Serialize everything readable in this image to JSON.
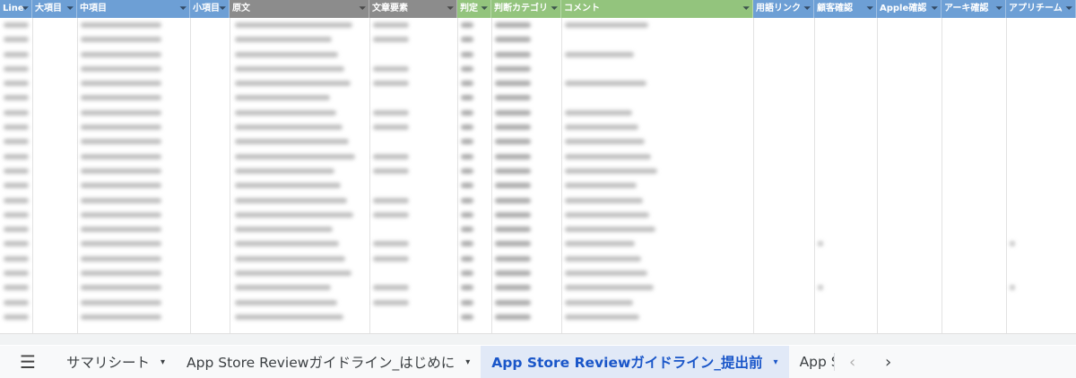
{
  "header": {
    "columns": [
      {
        "label": "Line",
        "filter": "⏷"
      },
      {
        "label": "大項目",
        "filter": "⏷"
      },
      {
        "label": "中項目",
        "filter": "⏷"
      },
      {
        "label": "小項目",
        "filter": "⏷"
      },
      {
        "label": "原文",
        "filter": "⏷"
      },
      {
        "label": "文章要素",
        "filter": "⏷"
      },
      {
        "label": "判定",
        "filter": "⏷"
      },
      {
        "label": "判断カテゴリ",
        "filter": "⏷"
      },
      {
        "label": "コメント",
        "filter": "⏷"
      },
      {
        "label": "用語リンク",
        "filter": "⏷"
      },
      {
        "label": "顧客確認",
        "filter": "⏷"
      },
      {
        "label": "Apple確認",
        "filter": "⏷"
      },
      {
        "label": "アーキ確認",
        "filter": "⏷"
      },
      {
        "label": "アプリチーム",
        "filter": "⏷"
      }
    ],
    "colors": {
      "blue": "#6d9fd5",
      "gray": "#8c8c8c",
      "green": "#93c47d"
    }
  },
  "sheet_tabs": {
    "menu_icon": "hamburger-menu-icon",
    "tabs": [
      {
        "label": "サマリシート",
        "caret": "▾"
      },
      {
        "label": "App Store Reviewガイドライン_はじめに",
        "caret": "▾"
      },
      {
        "label": "App Store Reviewガイドライン_提出前",
        "caret": "▾"
      },
      {
        "label": "App S"
      }
    ],
    "prev": "‹",
    "next": "›",
    "active_color": "#1a56c9"
  }
}
